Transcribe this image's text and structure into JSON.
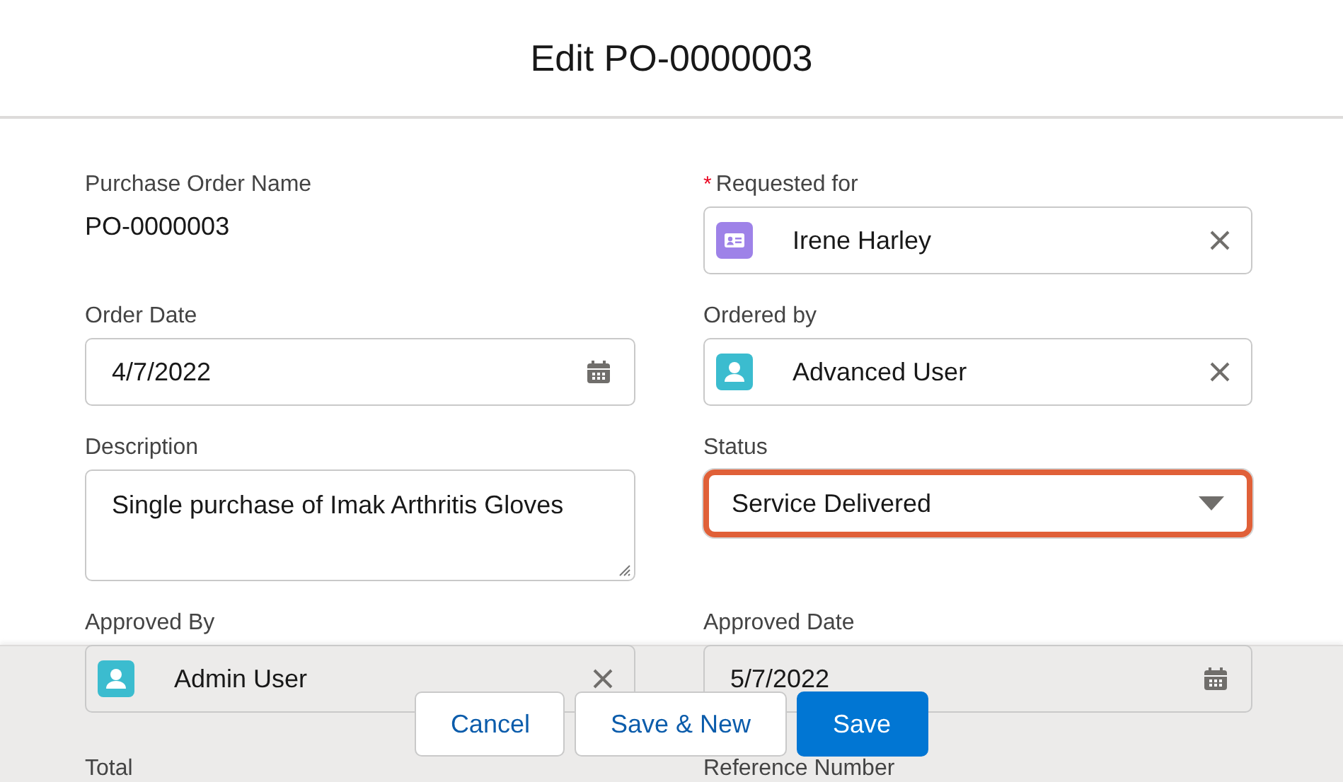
{
  "modal": {
    "title": "Edit PO-0000003"
  },
  "fields": [
    {
      "kind": "readonly",
      "label": "Purchase Order Name",
      "value": "PO-0000003"
    },
    {
      "kind": "contact_lookup",
      "label": "Requested for",
      "required_mark": "*",
      "value": "Irene Harley",
      "color": "#9e82e8",
      "focused": false
    },
    {
      "kind": "date",
      "label": "Order Date",
      "value": "4/7/2022",
      "focused": false
    },
    {
      "kind": "user_lookup",
      "label": "Ordered by",
      "value": "Advanced User",
      "color": "#3bbccf",
      "focused": false
    },
    {
      "kind": "textarea",
      "label": "Description",
      "value": "Single purchase of Imak Arthritis Gloves",
      "focused": false
    },
    {
      "kind": "picklist",
      "label": "Status",
      "value": "Service Delivered",
      "focused": true
    },
    {
      "kind": "user_lookup",
      "label": "Approved By",
      "value": "Admin User",
      "color": "#3bbccf",
      "focused": false
    },
    {
      "kind": "date",
      "label": "Approved Date",
      "value": "5/7/2022",
      "focused": false
    },
    {
      "kind": "label",
      "label": "Total"
    },
    {
      "kind": "label",
      "label": "Reference Number"
    }
  ],
  "footer": {
    "buttons": [
      {
        "label": "Cancel",
        "kind": "neutral"
      },
      {
        "label": "Save & New",
        "kind": "neutral"
      },
      {
        "label": "Save",
        "kind": "brand"
      }
    ]
  }
}
